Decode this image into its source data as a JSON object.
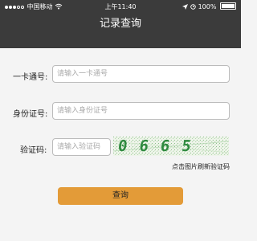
{
  "status_bar": {
    "carrier": "中国移动",
    "time": "上午11:40",
    "battery": "100%"
  },
  "header": {
    "title": "记录查询"
  },
  "form": {
    "card": {
      "label": "一卡通号:",
      "placeholder": "请输入一卡通号"
    },
    "id": {
      "label": "身份证号:",
      "placeholder": "请输入身份证号"
    },
    "captcha": {
      "label": "验证码:",
      "placeholder": "请输入验证码",
      "image_text": "0665",
      "hint": "点击图片刷新验证码"
    },
    "submit_label": "查询"
  },
  "colors": {
    "header_bg": "#3b3b3b",
    "button_bg": "#e39b38",
    "captcha_text": "#2f8a3f"
  }
}
